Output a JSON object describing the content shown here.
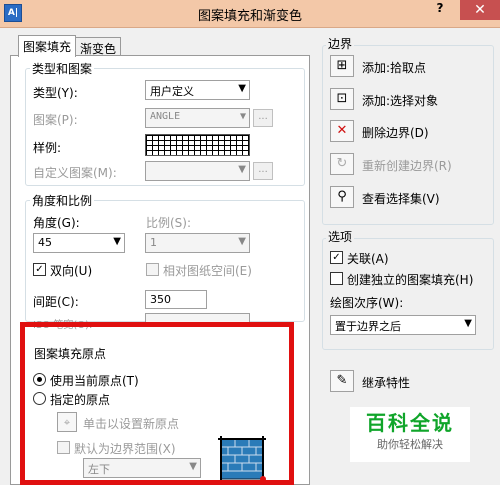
{
  "window": {
    "icon_text": "A|",
    "title": "图案填充和渐变色",
    "help": "?",
    "close": "✕"
  },
  "tabs": [
    {
      "label": "图案填充"
    },
    {
      "label": "渐变色"
    }
  ],
  "type_pattern": {
    "legend": "类型和图案",
    "type_label": "类型(Y):",
    "type_value": "用户定义",
    "pattern_label": "图案(P):",
    "pattern_value": "ANGLE",
    "sample_label": "样例:",
    "custom_label": "自定义图案(M):"
  },
  "angle_scale": {
    "legend": "角度和比例",
    "angle_label": "角度(G):",
    "angle_value": "45",
    "scale_label": "比例(S):",
    "scale_value": "1",
    "double_label": "双向(U)",
    "double_checked": "✓",
    "relative_label": "相对图纸空间(E)",
    "spacing_label": "间距(C):",
    "spacing_value": "350",
    "iso_label": "ISO 笔宽(O):"
  },
  "origin": {
    "legend": "图案填充原点",
    "use_current": "使用当前原点(T)",
    "specified": "指定的原点",
    "click_set": "单击以设置新原点",
    "default_extent": "默认为边界范围(X)",
    "extent_value": "左下"
  },
  "boundaries": {
    "legend": "边界",
    "add_pick": "添加:拾取点",
    "add_select": "添加:选择对象",
    "remove": "删除边界(D)",
    "recreate": "重新创建边界(R)",
    "view": "查看选择集(V)"
  },
  "options": {
    "legend": "选项",
    "associative": "关联(A)",
    "associative_checked": "✓",
    "independent": "创建独立的图案填充(H)",
    "draw_order_label": "绘图次序(W):",
    "draw_order_value": "置于边界之后"
  },
  "inherit": "继承特性",
  "watermark": {
    "line1": "百科全说",
    "line2": "助你轻松解决"
  }
}
